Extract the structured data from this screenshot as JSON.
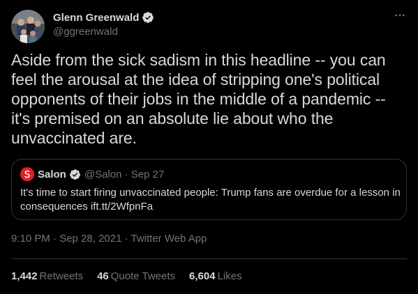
{
  "author": {
    "name": "Glenn Greenwald",
    "handle": "@ggreenwald",
    "verified": true
  },
  "tweet": {
    "text": "Aside from the sick sadism in this headline -- you can feel the arousal at the idea of stripping one's political opponents of their jobs in the middle of a pandemic -- it's premised on an absolute lie about who the unvaccinated are.",
    "timestamp": "9:10 PM · Sep 28, 2021 · Twitter Web App"
  },
  "quote": {
    "name": "Salon",
    "handle": "@Salon",
    "date": "Sep 27",
    "meta": "@Salon · Sep 27",
    "text": "It's time to start firing unvaccinated people: Trump fans are overdue for a lesson in consequences  ift.tt/2WfpnFa"
  },
  "stats": {
    "retweets_count": "1,442",
    "retweets_label": "Retweets",
    "quote_tweets_count": "46",
    "quote_tweets_label": "Quote Tweets",
    "likes_count": "6,604",
    "likes_label": "Likes"
  },
  "colors": {
    "background": "#000000",
    "text": "#d9d9d9",
    "secondary": "#6e767d",
    "border": "#2f3336",
    "verified": "#d9d9d9",
    "salon_brand": "#e21f26"
  },
  "icons": {
    "verified": "verified-badge-icon",
    "more": "more-horizontal-icon",
    "salon_logo": "salon-logo-icon"
  }
}
